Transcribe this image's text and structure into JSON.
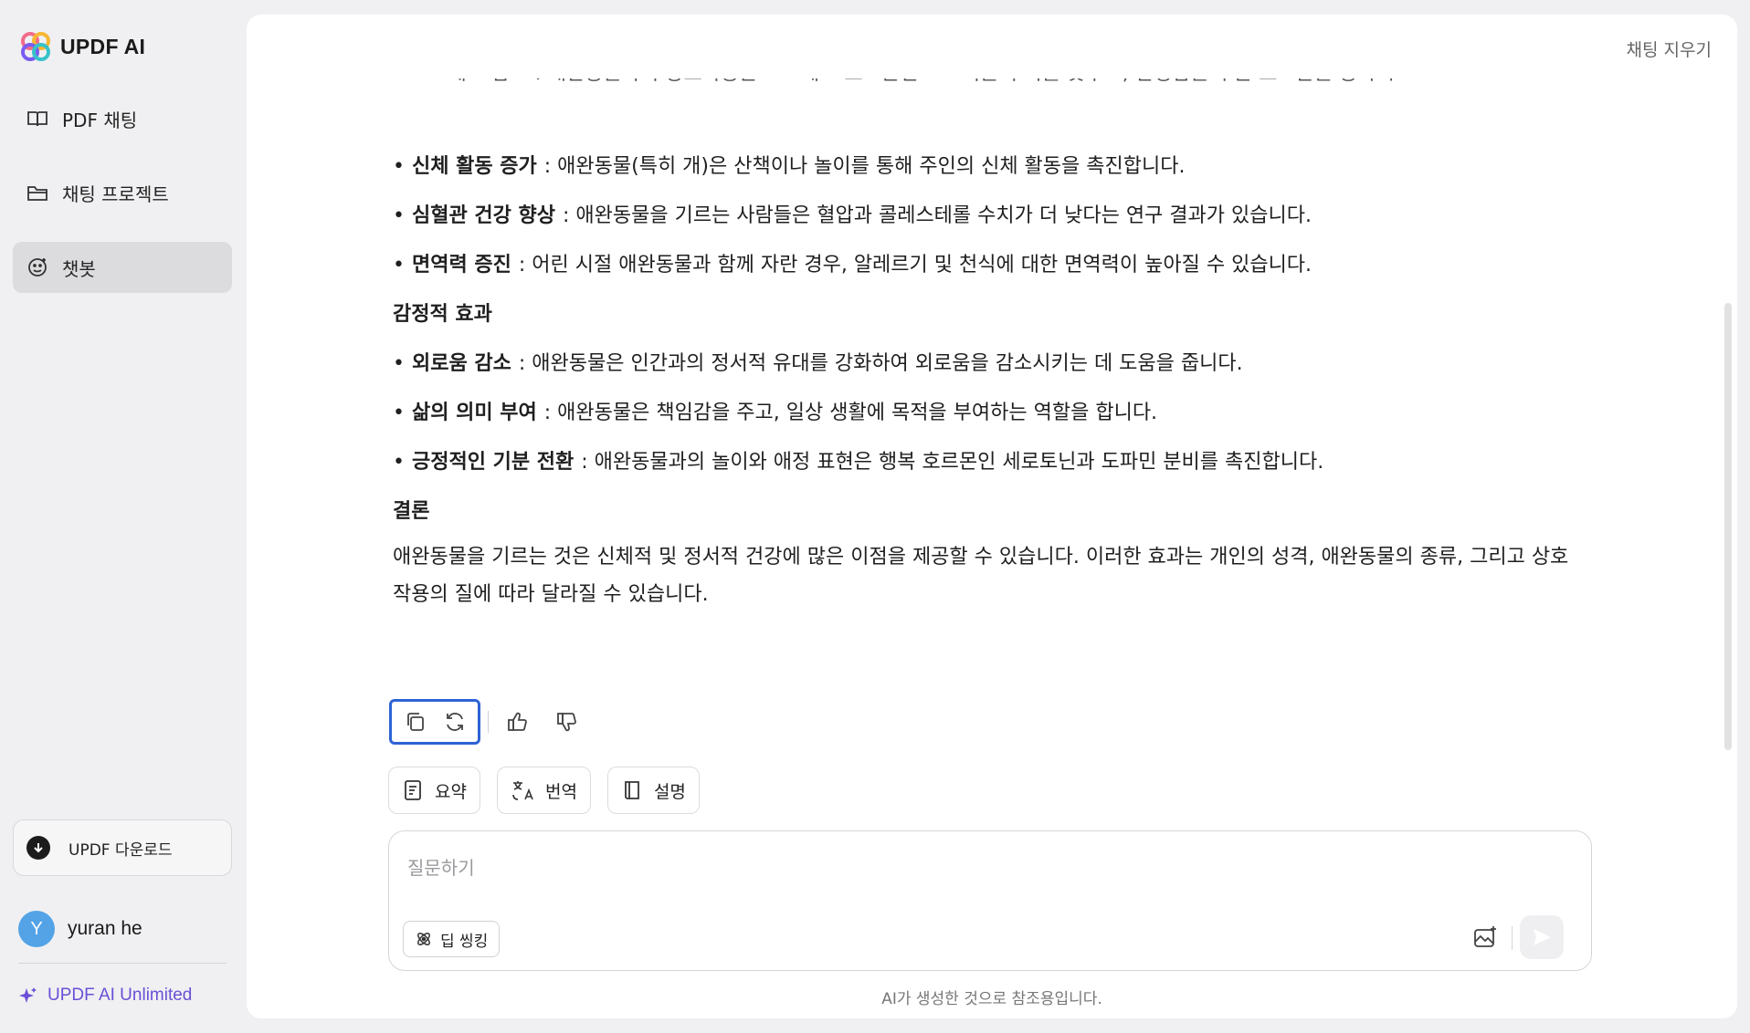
{
  "app": {
    "name": "UPDF AI"
  },
  "sidebar": {
    "items": [
      {
        "label": "PDF 채팅",
        "icon": "book-open-icon"
      },
      {
        "label": "채팅 프로젝트",
        "icon": "folder-icon"
      },
      {
        "label": "챗봇",
        "icon": "bot-icon",
        "active": true
      }
    ],
    "download_label": "UPDF 다운로드",
    "user": {
      "initial": "Y",
      "name": "yuran he"
    },
    "unlimited_label": "UPDF AI Unlimited"
  },
  "header": {
    "clear_label": "채팅 지우기"
  },
  "message": {
    "clipped_line": "• 스트레스 감소 : 애완동물과의 상호작용은 스트레스 호르몬인 코르티솔 수치를 낮추고, 안정감을 주는 호르몬을 증가시킵니다.",
    "bullets_physical": [
      {
        "title": "신체 활동 증가",
        "text": " : 애완동물(특히 개)은 산책이나 놀이를 통해 주인의 신체 활동을 촉진합니다."
      },
      {
        "title": "심혈관 건강 향상",
        "text": " : 애완동물을 기르는 사람들은 혈압과 콜레스테롤 수치가 더 낮다는 연구 결과가 있습니다."
      },
      {
        "title": "면역력 증진",
        "text": " : 어린 시절 애완동물과 함께 자란 경우, 알레르기 및 천식에 대한 면역력이 높아질 수 있습니다."
      }
    ],
    "heading_emotional": "감정적 효과",
    "bullets_emotional": [
      {
        "title": "외로움 감소",
        "text": " : 애완동물은 인간과의 정서적 유대를 강화하여 외로움을 감소시키는 데 도움을 줍니다."
      },
      {
        "title": "삶의 의미 부여",
        "text": " : 애완동물은 책임감을 주고, 일상 생활에 목적을 부여하는 역할을 합니다."
      },
      {
        "title": "긍정적인 기분 전환",
        "text": " : 애완동물과의 놀이와 애정 표현은 행복 호르몬인 세로토닌과 도파민 분비를 촉진합니다."
      }
    ],
    "heading_conclusion": "결론",
    "conclusion": "애완동물을 기르는 것은 신체적 및 정서적 건강에 많은 이점을 제공할 수 있습니다. 이러한 효과는 개인의 성격, 애완동물의 종류, 그리고 상호작용의 질에 따라 달라질 수 있습니다."
  },
  "quick_actions": [
    {
      "label": "요약",
      "icon": "summary-icon"
    },
    {
      "label": "번역",
      "icon": "translate-icon"
    },
    {
      "label": "설명",
      "icon": "explain-book-icon"
    }
  ],
  "input": {
    "placeholder": "질문하기",
    "deep_think_label": "딥 씽킹"
  },
  "disclaimer": "AI가 생성한 것으로 참조용입니다."
}
